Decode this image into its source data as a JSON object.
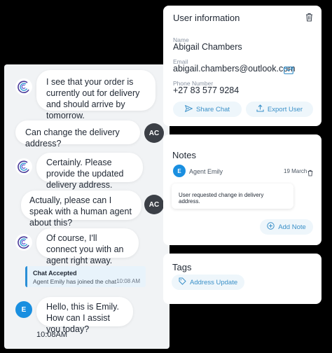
{
  "chat": {
    "messages": [
      {
        "sender": "bot",
        "text": "I see that your order is currently out for delivery and should arrive by tomorrow."
      },
      {
        "sender": "user",
        "text": "Can change the delivery address?",
        "initials": "AC"
      },
      {
        "sender": "bot",
        "text": "Certainly. Please provide the updated delivery address."
      },
      {
        "sender": "user",
        "text": "Actually, please can I speak with a human agent about this?",
        "initials": "AC"
      },
      {
        "sender": "bot",
        "text": "Of course, I'll connect you with an agent right away."
      },
      {
        "sender": "agent",
        "text": "Hello, this is Emily. How can I assist you today?",
        "initials": "E"
      }
    ],
    "system": {
      "title": "Chat Accepted",
      "text": "Agent Emily has joined the chat",
      "time": "10:08 AM"
    },
    "timestamp": "10:08AM"
  },
  "user_info": {
    "title": "User information",
    "name_label": "Name",
    "name": "Abigail Chambers",
    "email_label": "Email",
    "email": "abigail.chambers@outlook.com",
    "phone_label": "Phone Number",
    "phone": "+27 83 577 9284",
    "share_label": "Share Chat",
    "export_label": "Export User"
  },
  "notes": {
    "title": "Notes",
    "author_initial": "E",
    "author": "Agent Emily",
    "date": "19 March",
    "text": "User requested change in delivery address.",
    "add_label": "Add Note"
  },
  "tags": {
    "title": "Tags",
    "items": [
      "Address Update"
    ]
  },
  "colors": {
    "accent": "#3a90c8",
    "agent": "#1a8fe0",
    "user_avatar": "#3b3f46",
    "chip_bg": "#eef6fb"
  },
  "icons": [
    "bot-logo-icon",
    "trash-icon",
    "mail-icon",
    "send-icon",
    "upload-icon",
    "plus-circle-icon",
    "tag-icon"
  ]
}
